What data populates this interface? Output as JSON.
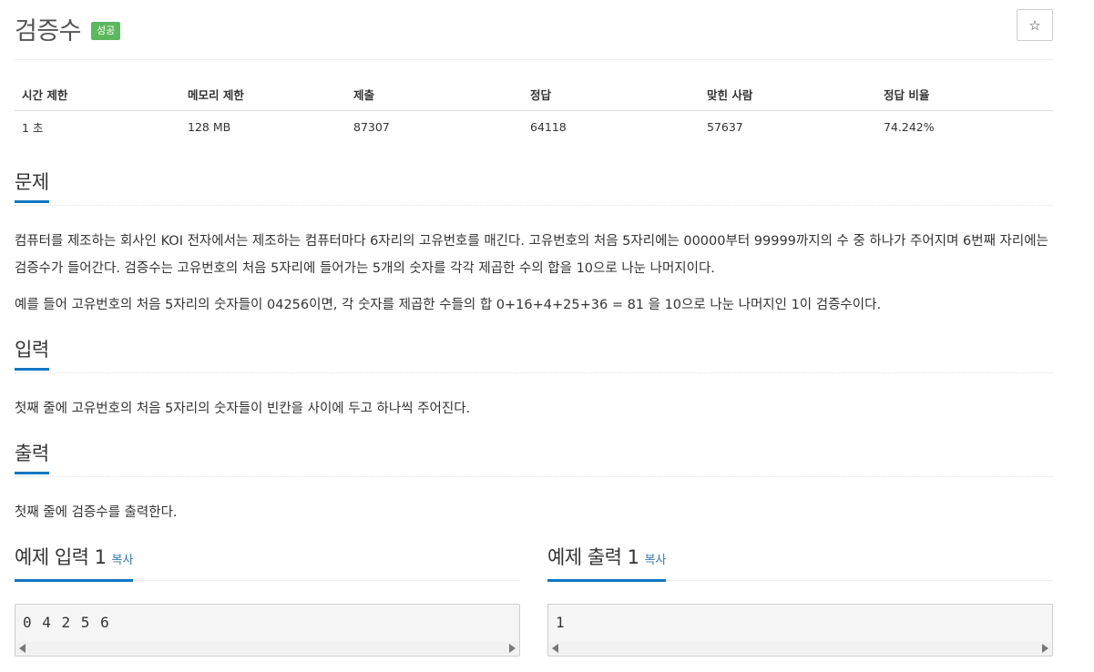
{
  "problem": {
    "title": "검증수",
    "badge": "성공",
    "star_icon": "star-icon"
  },
  "info_table": {
    "headers": [
      "시간 제한",
      "메모리 제한",
      "제출",
      "정답",
      "맞힌 사람",
      "정답 비율"
    ],
    "values": [
      "1 초",
      "128 MB",
      "87307",
      "64118",
      "57637",
      "74.242%"
    ]
  },
  "sections": {
    "description": {
      "heading": "문제",
      "paragraphs": [
        "컴퓨터를 제조하는 회사인 KOI 전자에서는 제조하는 컴퓨터마다 6자리의 고유번호를 매긴다. 고유번호의 처음 5자리에는 00000부터 99999까지의 수 중 하나가 주어지며 6번째 자리에는 검증수가 들어간다. 검증수는 고유번호의 처음 5자리에 들어가는 5개의 숫자를 각각 제곱한 수의 합을 10으로 나눈 나머지이다.",
        "예를 들어 고유번호의 처음 5자리의 숫자들이 04256이면, 각 숫자를 제곱한 수들의 합 0+16+4+25+36 = 81 을 10으로 나눈 나머지인 1이 검증수이다."
      ]
    },
    "input": {
      "heading": "입력",
      "text": "첫째 줄에 고유번호의 처음 5자리의 숫자들이 빈칸을 사이에 두고 하나씩 주어진다."
    },
    "output": {
      "heading": "출력",
      "text": "첫째 줄에 검증수를 출력한다."
    }
  },
  "samples": {
    "input": {
      "title": "예제 입력 1",
      "copy": "복사",
      "content": "0 4 2 5 6"
    },
    "output": {
      "title": "예제 출력 1",
      "copy": "복사",
      "content": "1"
    }
  },
  "colors": {
    "accent": "#0e76c4",
    "badge_success": "#5cb85c",
    "link": "#337ab7"
  }
}
